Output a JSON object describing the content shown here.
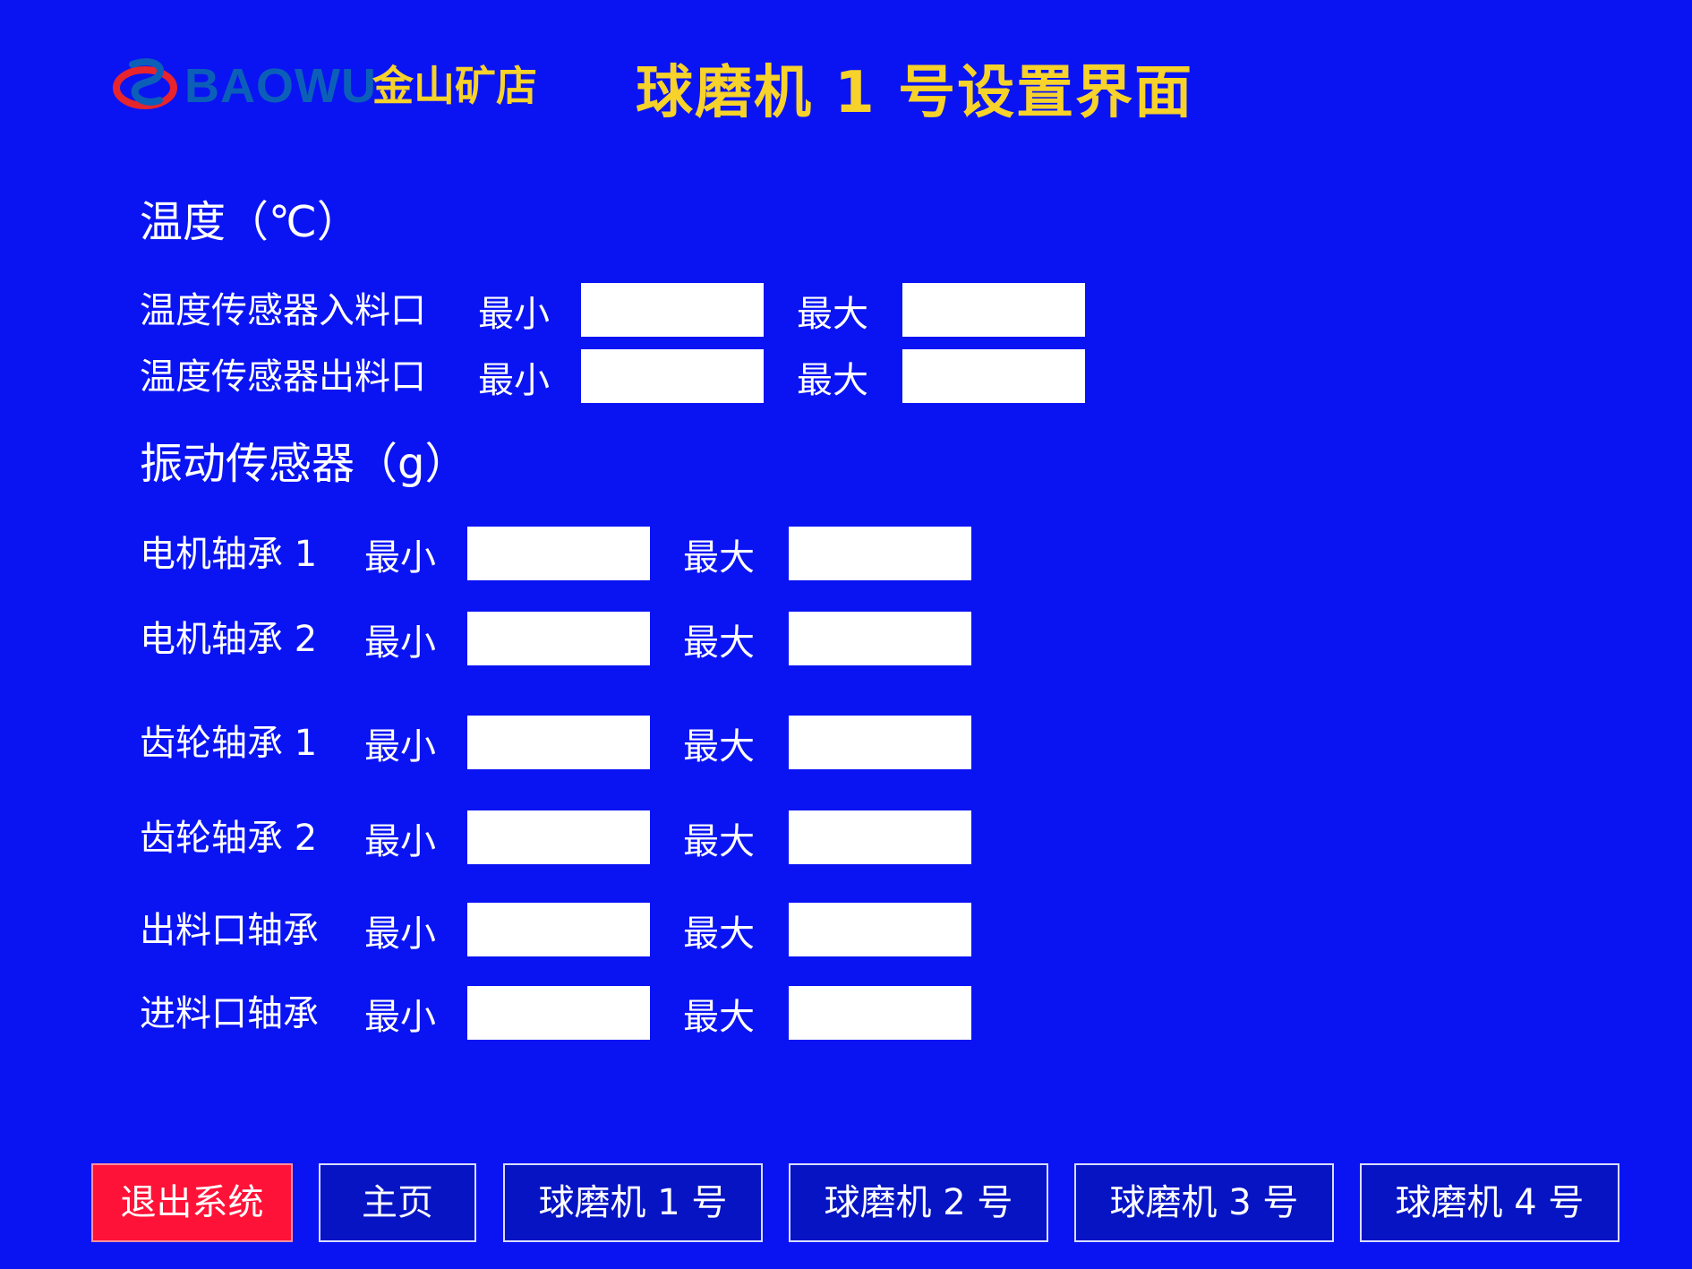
{
  "header": {
    "logo_text": "BAOWU",
    "store_name": "金山矿店",
    "title": "球磨机 1 号设置界面"
  },
  "temperature": {
    "heading": "温度（℃）",
    "rows": [
      {
        "label": "温度传感器入料口",
        "min_label": "最小",
        "max_label": "最大",
        "min_value": "",
        "max_value": ""
      },
      {
        "label": "温度传感器出料口",
        "min_label": "最小",
        "max_label": "最大",
        "min_value": "",
        "max_value": ""
      }
    ]
  },
  "vibration": {
    "heading": "振动传感器（g）",
    "rows": [
      {
        "label": "电机轴承 1",
        "min_label": "最小",
        "max_label": "最大",
        "min_value": "",
        "max_value": ""
      },
      {
        "label": "电机轴承 2",
        "min_label": "最小",
        "max_label": "最大",
        "min_value": "",
        "max_value": ""
      },
      {
        "label": "齿轮轴承 1",
        "min_label": "最小",
        "max_label": "最大",
        "min_value": "",
        "max_value": ""
      },
      {
        "label": "齿轮轴承 2",
        "min_label": "最小",
        "max_label": "最大",
        "min_value": "",
        "max_value": ""
      },
      {
        "label": "出料口轴承",
        "min_label": "最小",
        "max_label": "最大",
        "min_value": "",
        "max_value": ""
      },
      {
        "label": "进料口轴承",
        "min_label": "最小",
        "max_label": "最大",
        "min_value": "",
        "max_value": ""
      }
    ]
  },
  "nav": {
    "exit": "退出系统",
    "home": "主页",
    "mill1": "球磨机 1 号",
    "mill2": "球磨机 2 号",
    "mill3": "球磨机 3 号",
    "mill4": "球磨机 4 号"
  },
  "colors": {
    "background": "#0a14f2",
    "title_yellow": "#f6d22a",
    "exit_red": "#ff1238",
    "logo_blue": "#0c5fb8",
    "logo_red": "#e8242c"
  }
}
